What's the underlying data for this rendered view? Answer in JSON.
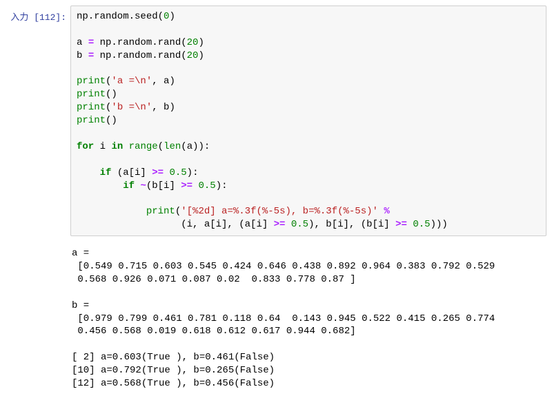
{
  "prompt": {
    "label": "入力 [112]:"
  },
  "code": {
    "l01": "np.random.seed(",
    "l01n": "0",
    "l01b": ")",
    "l03a": "a ",
    "l03op": "=",
    "l03b": " np.random.rand(",
    "l03n": "20",
    "l03c": ")",
    "l04a": "b ",
    "l04op": "=",
    "l04b": " np.random.rand(",
    "l04n": "20",
    "l04c": ")",
    "print": "print",
    "l06s": "'a =\\n'",
    "l06b": ", a)",
    "l07": "()",
    "l08s": "'b =\\n'",
    "l08b": ", b)",
    "l09": "()",
    "for": "for",
    "in": "in",
    "l11a": " i ",
    "l11b": " ",
    "range": "range",
    "len": "len",
    "l11c": "(",
    "l11d": "(a)):",
    "if": "if",
    "l13a": "    ",
    "l13b": " (a[i] ",
    "ge": ">=",
    "l13c": " ",
    "l13n": "0.5",
    "l13d": "):",
    "tilde": "~",
    "l14a": "        ",
    "l14b": " ",
    "l14c": "(b[i] ",
    "l14d": " ",
    "l14e": "):",
    "l16a": "            ",
    "l16s": "'[%2d] a=%.3f(%-5s), b=%.3f(%-5s)'",
    "pct": "%",
    "l17a": "                  (i, a[i], (a[i] ",
    "l17b": " ",
    "l17c": "), b[i], (b[i] ",
    "l17d": " ",
    "l17e": ")))"
  },
  "output": {
    "text": "a =\n [0.549 0.715 0.603 0.545 0.424 0.646 0.438 0.892 0.964 0.383 0.792 0.529\n 0.568 0.926 0.071 0.087 0.02  0.833 0.778 0.87 ]\n\nb =\n [0.979 0.799 0.461 0.781 0.118 0.64  0.143 0.945 0.522 0.415 0.265 0.774\n 0.456 0.568 0.019 0.618 0.612 0.617 0.944 0.682]\n\n[ 2] a=0.603(True ), b=0.461(False)\n[10] a=0.792(True ), b=0.265(False)\n[12] a=0.568(True ), b=0.456(False)"
  }
}
